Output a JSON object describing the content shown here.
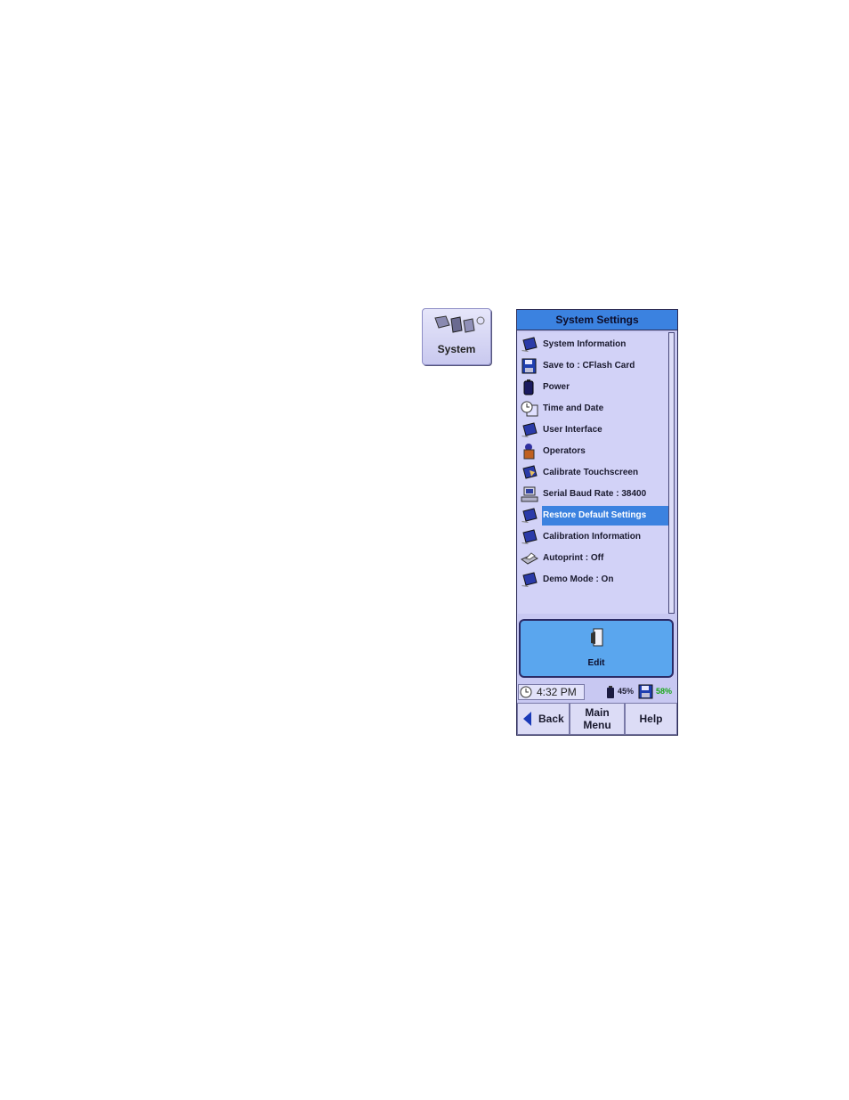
{
  "system_shortcut": {
    "label": "System",
    "icon": "system-settings-icon"
  },
  "panel": {
    "title": "System Settings",
    "items": [
      {
        "label": "System Information",
        "icon": "device-icon"
      },
      {
        "label": "Save to : CFlash Card",
        "icon": "floppy-disk-icon"
      },
      {
        "label": "Power",
        "icon": "battery-icon"
      },
      {
        "label": "Time and Date",
        "icon": "clock-calendar-icon"
      },
      {
        "label": "User Interface",
        "icon": "device-icon"
      },
      {
        "label": "Operators",
        "icon": "operator-icon"
      },
      {
        "label": "Calibrate Touchscreen",
        "icon": "touchscreen-icon"
      },
      {
        "label": "Serial Baud Rate : 38400",
        "icon": "computer-icon"
      },
      {
        "label": "Restore Default Settings",
        "icon": "device-icon",
        "selected": true
      },
      {
        "label": "Calibration Information",
        "icon": "device-icon"
      },
      {
        "label": "Autoprint : Off",
        "icon": "printer-icon"
      },
      {
        "label": "Demo Mode : On",
        "icon": "device-icon"
      }
    ],
    "edit_label": "Edit",
    "status": {
      "time": "4:32 PM",
      "battery": "45%",
      "storage": "58%"
    },
    "nav": {
      "back": "Back",
      "main_line1": "Main",
      "main_line2": "Menu",
      "help": "Help"
    },
    "colors": {
      "title_bar": "#3b82e0",
      "selection": "#3b82e0",
      "panel_bg": "#c8c8f2",
      "edit_button": "#5aa6ee",
      "storage_text": "#1aa81a"
    }
  }
}
